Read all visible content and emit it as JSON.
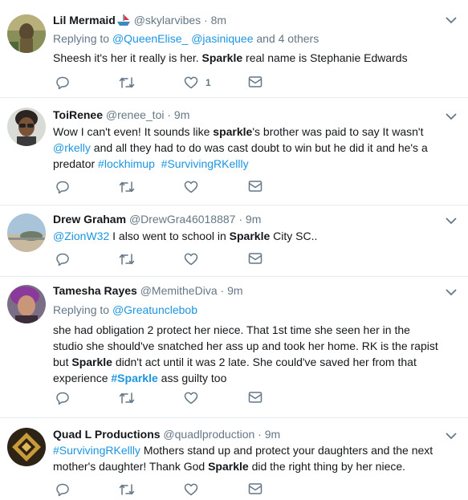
{
  "tweets": [
    {
      "name": "Lil Mermaid",
      "handle": "@skylarvibes",
      "time": "8m",
      "reply_prefix": "Replying to ",
      "reply_mentions": [
        "@QueenElise_",
        "@jasiniquee"
      ],
      "reply_suffix": " and 4 others",
      "text_parts": [
        "Sheesh it's her it really is her. ",
        "Sparkle",
        " real name is Stephanie Edwards"
      ],
      "like_count": "1"
    },
    {
      "name": "ToiRenee",
      "handle": "@renee_toi",
      "time": "9m",
      "text_parts": [
        "Wow I can't even! It sounds like ",
        "sparkle",
        "'s brother was paid to say It wasn't ",
        "@rkelly",
        " and all they had to do was cast doubt to win but he did it and he's a predator ",
        "#lockhimup",
        "  ",
        "#SurvivingRKellly"
      ]
    },
    {
      "name": "Drew Graham",
      "handle": "@DrewGra46018887",
      "time": "9m",
      "text_parts": [
        "@ZionW32",
        " I also went to school in ",
        "Sparkle",
        " City SC.."
      ]
    },
    {
      "name": "Tamesha Rayes",
      "handle": "@MemitheDiva",
      "time": "9m",
      "reply_prefix": "Replying to ",
      "reply_mentions": [
        "@Greatunclebob"
      ],
      "text_parts": [
        "she had obligation 2 protect her niece. That 1st time she seen her in the studio she should've snatched her ass up and took her home. RK is the rapist but ",
        "Sparkle",
        " didn't act until it was 2 late. She could've saved her from that experience ",
        "#Sparkle",
        " ass guilty too"
      ]
    },
    {
      "name": "Quad L Productions",
      "handle": "@quadlproduction",
      "time": "9m",
      "text_parts": [
        "#SurvivingRKellly",
        " Mothers stand up and protect your daughters and the next mother's daughter! Thank God ",
        "Sparkle",
        " did the right thing by her niece."
      ]
    }
  ],
  "separator": " · ",
  "icons": {
    "reply": "reply-icon",
    "retweet": "retweet-icon",
    "like": "heart-icon",
    "dm": "envelope-icon",
    "caret": "chevron-down-icon",
    "badge": "boat-emoji-icon"
  },
  "colors": {
    "link": "#1b95e0",
    "secondary": "#657786",
    "text": "#14171a",
    "divider": "#e6ecf0"
  }
}
